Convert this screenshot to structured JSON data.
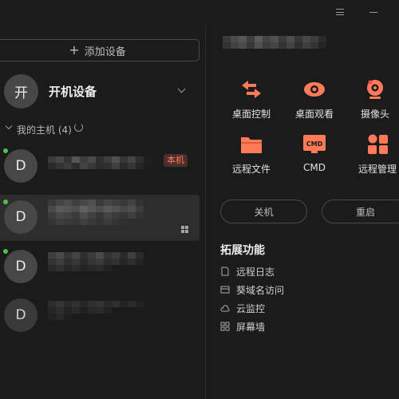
{
  "titlebar": {
    "menu_icon": "menu-icon",
    "minimize_icon": "minimize-icon"
  },
  "sidebar": {
    "add_device_label": "添加设备",
    "power_on": {
      "avatar": "开",
      "label": "开机设备"
    },
    "group": {
      "label": "我的主机 (4)"
    },
    "devices": [
      {
        "avatar": "D",
        "online": true,
        "badge": "本机",
        "selected": false
      },
      {
        "avatar": "D",
        "online": true,
        "badge": "",
        "os_icon": "windows-icon",
        "selected": true
      },
      {
        "avatar": "D",
        "online": true,
        "badge": "",
        "selected": false
      },
      {
        "avatar": "D",
        "online": false,
        "badge": "",
        "selected": false
      }
    ]
  },
  "detail": {
    "actions": [
      {
        "label": "桌面控制",
        "icon": "remote-control-icon"
      },
      {
        "label": "桌面观看",
        "icon": "eye-icon"
      },
      {
        "label": "摄像头",
        "icon": "camera-icon"
      },
      {
        "label": "远程文件",
        "icon": "folder-icon"
      },
      {
        "label": "CMD",
        "icon": "cmd-icon",
        "icon_text": "CMD"
      },
      {
        "label": "远程管理",
        "icon": "manage-grid-icon"
      }
    ],
    "shutdown_label": "关机",
    "restart_label": "重启",
    "extensions": {
      "title": "拓展功能",
      "items": [
        {
          "label": "远程日志",
          "icon": "log-icon"
        },
        {
          "label": "葵域名访问",
          "icon": "domain-icon"
        },
        {
          "label": "云监控",
          "icon": "cloud-icon"
        },
        {
          "label": "屏幕墙",
          "icon": "screen-wall-icon"
        }
      ]
    }
  },
  "colors": {
    "accent": "#ff7a59",
    "online": "#4cc44c",
    "background": "#1b1b1b"
  }
}
